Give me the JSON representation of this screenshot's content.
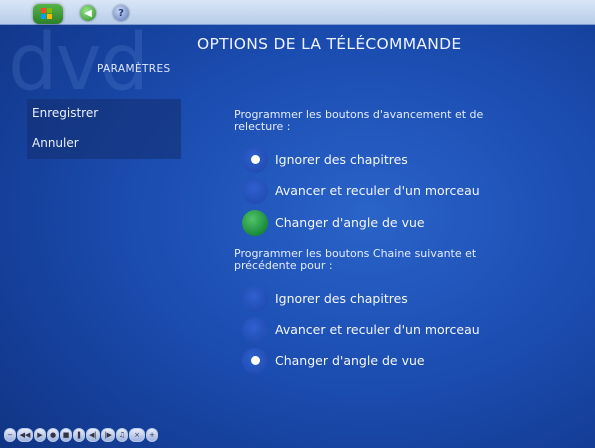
{
  "header": {
    "title": "OPTIONS DE LA TÉLÉCOMMANDE",
    "section": "PARAMÈTRES",
    "watermark": "dvd"
  },
  "toolbar": {
    "start_icon": "windows-flag-icon",
    "back_icon": "back-arrow-icon",
    "help_icon": "help-icon"
  },
  "sidebar": {
    "items": [
      {
        "label": "Enregistrer"
      },
      {
        "label": "Annuler"
      }
    ]
  },
  "group1": {
    "label": "Programmer les boutons d'avancement et de relecture :",
    "options": [
      {
        "label": "Ignorer des chapitres",
        "selected": true,
        "focused": false
      },
      {
        "label": "Avancer et reculer d'un morceau",
        "selected": false,
        "focused": false
      },
      {
        "label": "Changer d'angle de vue",
        "selected": false,
        "focused": true
      }
    ]
  },
  "group2": {
    "label": "Programmer les boutons Chaine suivante et précédente pour :",
    "options": [
      {
        "label": "Ignorer des chapitres",
        "selected": false,
        "focused": false
      },
      {
        "label": "Avancer et reculer d'un morceau",
        "selected": false,
        "focused": false
      },
      {
        "label": "Changer d'angle de vue",
        "selected": true,
        "focused": false
      }
    ]
  },
  "colors": {
    "background": "#1b4cb0",
    "focus_green": "#1b8a3a",
    "panel": "#142d6e"
  },
  "transport_controls": [
    "minus-icon",
    "rewind-icon",
    "play-icon",
    "record-icon",
    "stop-icon",
    "pause-icon",
    "skip-back-icon",
    "skip-forward-icon",
    "volume-icon",
    "mute-icon",
    "plus-icon"
  ]
}
